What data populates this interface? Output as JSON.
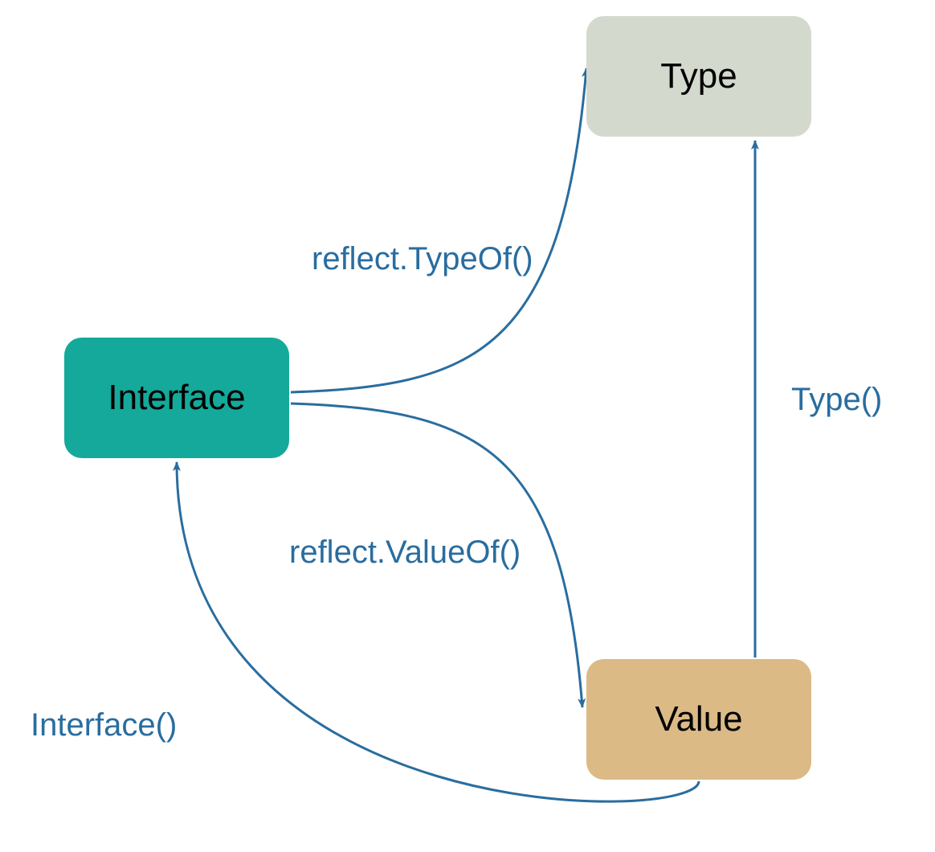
{
  "nodes": {
    "interface": {
      "label": "Interface"
    },
    "type": {
      "label": "Type"
    },
    "value": {
      "label": "Value"
    }
  },
  "edges": {
    "typeof": {
      "label": "reflect.TypeOf()"
    },
    "valueof": {
      "label": "reflect.ValueOf()"
    },
    "type_method": {
      "label": "Type()"
    },
    "interface_method": {
      "label": "Interface()"
    }
  },
  "colors": {
    "arrow": "#296d9f",
    "node_interface": "#14a99a",
    "node_type": "#d4d9ce",
    "node_value": "#dbba86",
    "text_label": "#296d9f"
  }
}
